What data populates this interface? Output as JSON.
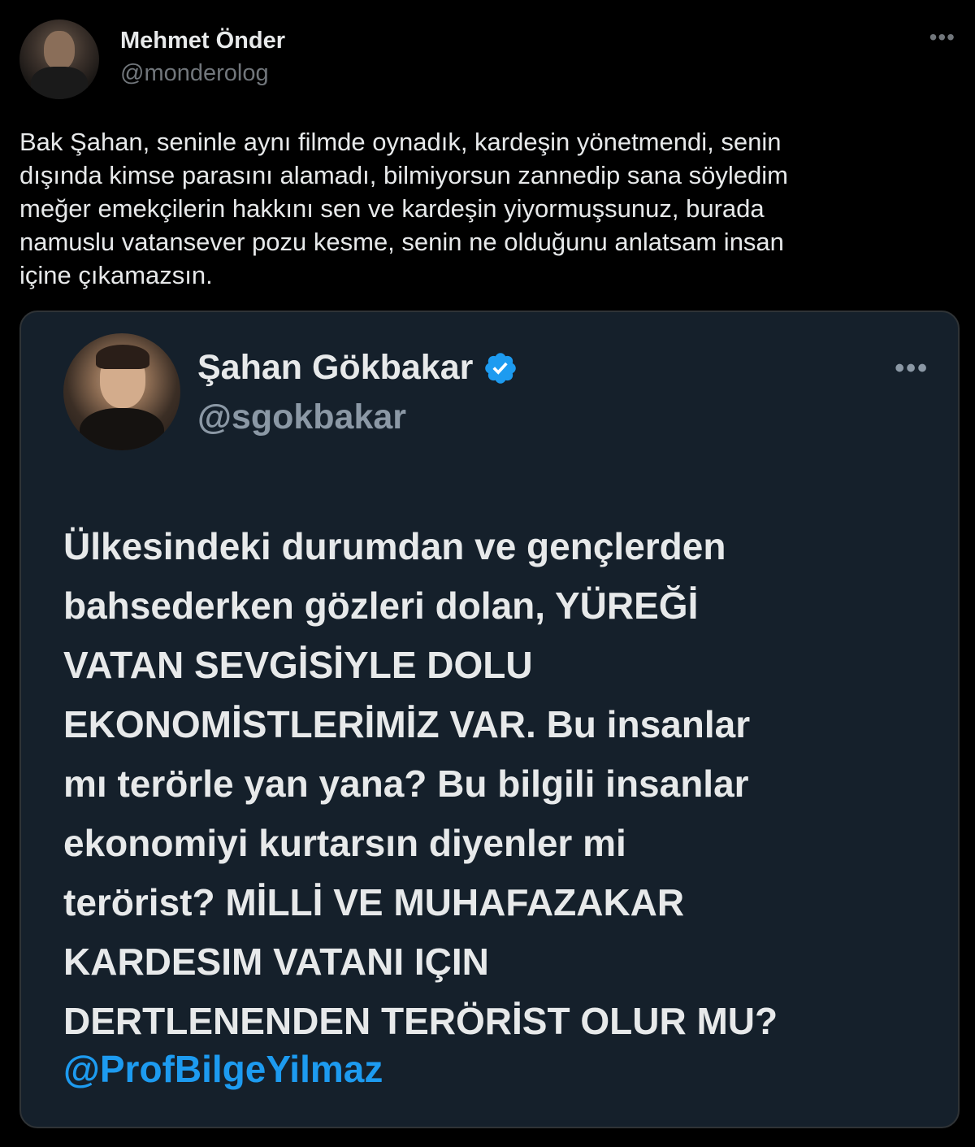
{
  "tweet": {
    "author_name": "Mehmet Önder",
    "author_handle": "@monderolog",
    "more_icon": "more-icon",
    "text": "Bak Şahan, seninle aynı filmde oynadık, kardeşin yönetmendi, senin\ndışında kimse parasını alamadı, bilmiyorsun zannedip sana söyledim\nmeğer emekçilerin hakkını sen ve kardeşin yiyormuşsunuz, burada\nnamuslu vatansever pozu kesme, senin ne olduğunu anlatsam insan\niçine çıkamazsın."
  },
  "quoted": {
    "author_name": "Şahan Gökbakar",
    "author_handle": "@sgokbakar",
    "verified_icon": "verified-badge-icon",
    "verified_color": "#1d9bf0",
    "lines": [
      "Ülkesindeki durumdan ve gençlerden",
      "bahsederken gözleri dolan, YÜREĞİ",
      "VATAN SEVGİSİYLE DOLU",
      "EKONOMİSTLERİMİZ VAR. Bu insanlar",
      "mı terörle yan yana? Bu bilgili insanlar",
      "ekonomiyi kurtarsın diyenler mi",
      "terörist? MİLLİ VE MUHAFAZAKAR",
      "KARDESIM VATANI IÇIN",
      "DERTLENENDEN TERÖRİST OLUR MU?"
    ],
    "mention": "@ProfBilgeYilmaz",
    "mention_color": "#1d9bf0"
  },
  "colors": {
    "background": "#000000",
    "card_background": "#15202b",
    "text": "#e7e9ea",
    "secondary_text": "#71767b"
  }
}
